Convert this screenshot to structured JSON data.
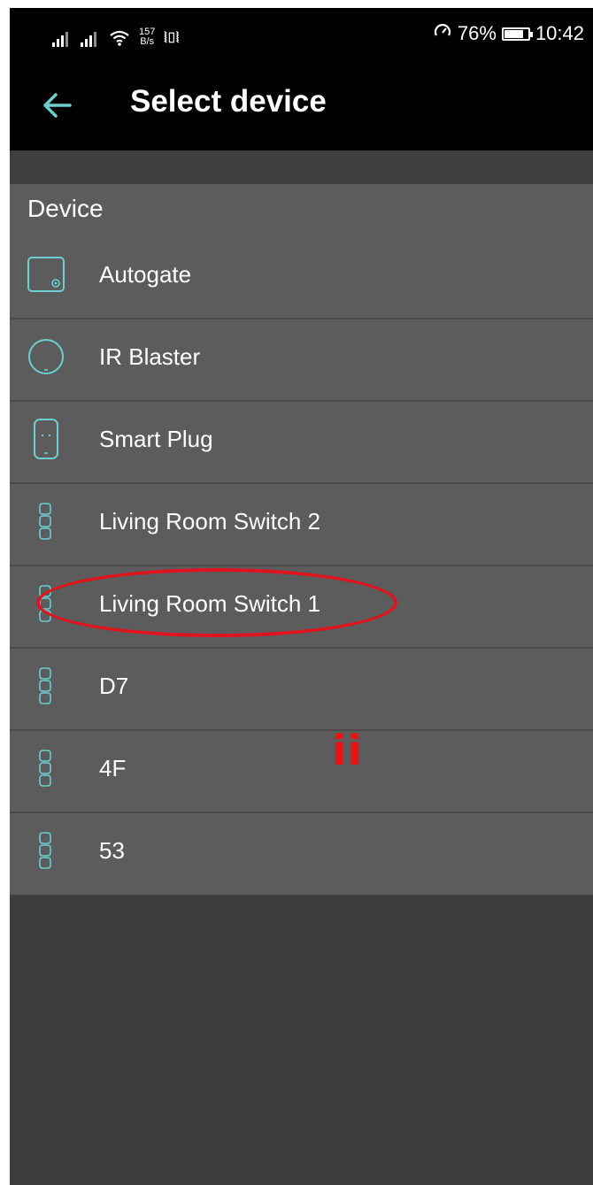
{
  "status_bar": {
    "network_speed_value": "157",
    "network_speed_unit": "B/s",
    "battery_percent": "76%",
    "time": "10:42",
    "icons": [
      "signal-icon",
      "signal-icon",
      "wifi-icon",
      "vibrate-icon",
      "data-saver-icon",
      "battery-icon"
    ]
  },
  "app_bar": {
    "title": "Select device",
    "back_icon": "back-arrow-icon"
  },
  "section_header": "Device",
  "devices": [
    {
      "label": "Autogate",
      "icon": "autogate-icon"
    },
    {
      "label": "IR Blaster",
      "icon": "ir-blaster-icon"
    },
    {
      "label": "Smart Plug",
      "icon": "smart-plug-icon"
    },
    {
      "label": "Living Room Switch 2",
      "icon": "switch-icon"
    },
    {
      "label": "Living Room Switch 1",
      "icon": "switch-icon"
    },
    {
      "label": "D7",
      "icon": "switch-icon"
    },
    {
      "label": "4F",
      "icon": "switch-icon"
    },
    {
      "label": "53",
      "icon": "switch-icon"
    }
  ],
  "annotation": {
    "text": "ii",
    "color": "#e0141e",
    "highlighted_item": "Living Room Switch 1"
  },
  "colors": {
    "accent": "#6ccfd0",
    "list_background": "#5c5c5c",
    "bar_background": "#000000"
  }
}
